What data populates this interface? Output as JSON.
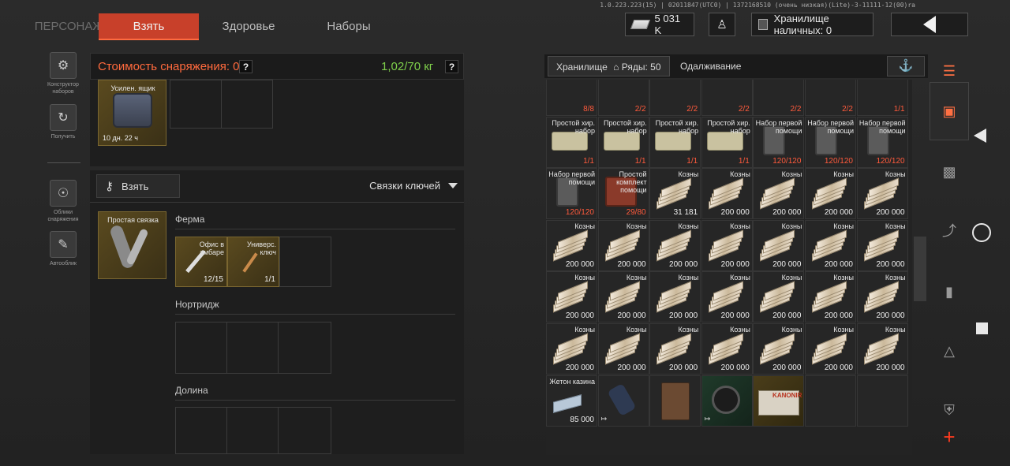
{
  "version": "1.0.223.223(15) | 02011847(UTC0) | 1372168510 (очень низкая)(Lite)-3-11111-12(00)ra",
  "tabs": [
    {
      "label": "ПЕРСОНАЖ",
      "state": "dim"
    },
    {
      "label": "Взять",
      "state": "active"
    },
    {
      "label": "Здоровье",
      "state": "normal"
    },
    {
      "label": "Наборы",
      "state": "normal"
    }
  ],
  "wallet": "5 031 K",
  "cash_storage": "Хранилище наличных: 0",
  "left_nav": [
    {
      "label": "Конструктор наборов",
      "icon": "kit-builder-icon"
    },
    {
      "label": "Получить",
      "icon": "receive-icon"
    },
    {
      "label": "Облики снаряжения",
      "icon": "skin-icon"
    },
    {
      "label": "Автооблик",
      "icon": "auto-skin-icon"
    }
  ],
  "loadout": {
    "cost_label": "Стоимость снаряжения: 0",
    "weight": "1,02/70 кг",
    "hint": "?",
    "container": {
      "name": "Усилен. ящик",
      "timer": "10 дн. 22 ч"
    },
    "take_button": "Взять",
    "keys_dropdown": "Связки ключей",
    "keyring": {
      "name": "Простая связка"
    },
    "sections": [
      {
        "title": "Ферма",
        "items": [
          {
            "name": "Офис в амбаре",
            "count": "12/15"
          },
          {
            "name": "Универс. ключ",
            "count": "1/1"
          }
        ]
      },
      {
        "title": "Нортридж",
        "items": []
      },
      {
        "title": "Долина",
        "items": []
      }
    ]
  },
  "storage": {
    "tab_storage": "Хранилище",
    "rows_label": "Ряды: 50",
    "tab_lending": "Одалживание",
    "rows": [
      [
        {
          "name": "",
          "count": "8/8",
          "red": true
        },
        {
          "name": "",
          "count": "2/2",
          "red": true
        },
        {
          "name": "",
          "count": "2/2",
          "red": true
        },
        {
          "name": "",
          "count": "2/2",
          "red": true
        },
        {
          "name": "",
          "count": "2/2",
          "red": true
        },
        {
          "name": "",
          "count": "2/2",
          "red": true
        },
        {
          "name": "",
          "count": "1/1",
          "red": true
        }
      ],
      [
        {
          "name": "Простой хир. набор",
          "count": "1/1",
          "red": true,
          "kind": "kit"
        },
        {
          "name": "Простой хир. набор",
          "count": "1/1",
          "red": true,
          "kind": "kit"
        },
        {
          "name": "Простой хир. набор",
          "count": "1/1",
          "red": true,
          "kind": "kit"
        },
        {
          "name": "Простой хир. набор",
          "count": "1/1",
          "red": true,
          "kind": "kit"
        },
        {
          "name": "Набор первой помощи",
          "count": "120/120",
          "red": true,
          "kind": "med"
        },
        {
          "name": "Набор первой помощи",
          "count": "120/120",
          "red": true,
          "kind": "med"
        },
        {
          "name": "Набор первой помощи",
          "count": "120/120",
          "red": true,
          "kind": "med"
        }
      ],
      [
        {
          "name": "Набор первой помощи",
          "count": "120/120",
          "red": true,
          "kind": "med"
        },
        {
          "name": "Простой комплект помощи",
          "count": "29/80",
          "red": true,
          "kind": "pouch"
        },
        {
          "name": "Козны",
          "count": "31 181",
          "kind": "cash"
        },
        {
          "name": "Козны",
          "count": "200 000",
          "kind": "cash"
        },
        {
          "name": "Козны",
          "count": "200 000",
          "kind": "cash"
        },
        {
          "name": "Козны",
          "count": "200 000",
          "kind": "cash"
        },
        {
          "name": "Козны",
          "count": "200 000",
          "kind": "cash"
        }
      ],
      [
        {
          "name": "Козны",
          "count": "200 000",
          "kind": "cash"
        },
        {
          "name": "Козны",
          "count": "200 000",
          "kind": "cash"
        },
        {
          "name": "Козны",
          "count": "200 000",
          "kind": "cash"
        },
        {
          "name": "Козны",
          "count": "200 000",
          "kind": "cash"
        },
        {
          "name": "Козны",
          "count": "200 000",
          "kind": "cash"
        },
        {
          "name": "Козны",
          "count": "200 000",
          "kind": "cash"
        },
        {
          "name": "Козны",
          "count": "200 000",
          "kind": "cash"
        }
      ],
      [
        {
          "name": "Козны",
          "count": "200 000",
          "kind": "cash"
        },
        {
          "name": "Козны",
          "count": "200 000",
          "kind": "cash"
        },
        {
          "name": "Козны",
          "count": "200 000",
          "kind": "cash"
        },
        {
          "name": "Козны",
          "count": "200 000",
          "kind": "cash"
        },
        {
          "name": "Козны",
          "count": "200 000",
          "kind": "cash"
        },
        {
          "name": "Козны",
          "count": "200 000",
          "kind": "cash"
        },
        {
          "name": "Козны",
          "count": "200 000",
          "kind": "cash"
        }
      ],
      [
        {
          "name": "Козны",
          "count": "200 000",
          "kind": "cash"
        },
        {
          "name": "Козны",
          "count": "200 000",
          "kind": "cash"
        },
        {
          "name": "Козны",
          "count": "200 000",
          "kind": "cash"
        },
        {
          "name": "Козны",
          "count": "200 000",
          "kind": "cash"
        },
        {
          "name": "Козны",
          "count": "200 000",
          "kind": "cash"
        },
        {
          "name": "Козны",
          "count": "200 000",
          "kind": "cash"
        },
        {
          "name": "Козны",
          "count": "200 000",
          "kind": "cash"
        }
      ],
      [
        {
          "name": "Жетон казина",
          "count": "85 000",
          "kind": "chip"
        },
        {
          "name": "",
          "count": "",
          "kind": "grenade"
        },
        {
          "name": "",
          "count": "",
          "kind": "notebook"
        },
        {
          "name": "",
          "count": "",
          "kind": "compass"
        },
        {
          "name": "KANONIR",
          "count": "",
          "kind": "box"
        },
        {
          "name": "",
          "count": "",
          "kind": "empty"
        },
        {
          "name": "",
          "count": "",
          "kind": "empty"
        }
      ]
    ]
  },
  "categories": [
    "stash-icon",
    "backpack-icon",
    "vest-icon",
    "rifle-icon",
    "magazine-icon",
    "bottle-icon",
    "armor-icon",
    "add-icon"
  ],
  "colors": {
    "accent": "#c8402a",
    "weight_ok": "#7fd04b",
    "count_red": "#ff5a3c",
    "add": "#ff3b1f"
  }
}
